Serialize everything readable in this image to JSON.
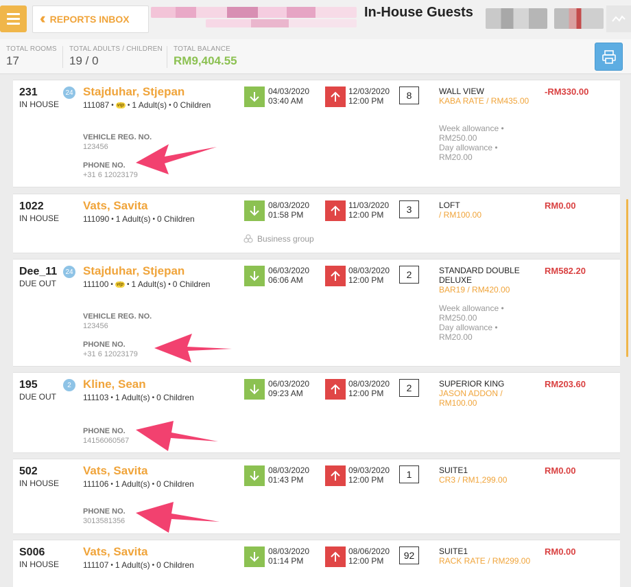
{
  "header": {
    "reports_label": "REPORTS INBOX",
    "title": "In-House Guests"
  },
  "stats": {
    "total_rooms_label": "TOTAL ROOMS",
    "total_rooms": "17",
    "adults_children_label": "TOTAL ADULTS / CHILDREN",
    "adults_children": "19 / 0",
    "balance_label": "TOTAL BALANCE",
    "balance": "RM9,404.55"
  },
  "colors": {
    "accent": "#f0a43a",
    "arrive_green": "#8cc152",
    "depart_red": "#e04646",
    "balance_red": "#d94141",
    "annotation_pink": "#f2416f"
  },
  "reservations": [
    {
      "room": "231",
      "status": "IN HOUSE",
      "badge": "24",
      "guest": "Stajduhar, Stjepan",
      "res_no": "111087",
      "vip": "vip",
      "adults": "1 Adult(s)",
      "children": "0 Children",
      "arrival_date": "04/03/2020",
      "arrival_time": "03:40 AM",
      "departure_date": "12/03/2020",
      "departure_time": "12:00 PM",
      "nights": "8",
      "room_type": "WALL VIEW",
      "rate": "KABA RATE / RM435.00",
      "allowance_week": "Week allowance •",
      "allowance_week_amt": "RM250.00",
      "allowance_day": "Day allowance •",
      "allowance_day_amt": "RM20.00",
      "vehicle_label": "VEHICLE REG. NO.",
      "vehicle": "123456",
      "phone_label": "PHONE NO.",
      "phone": "+31 6 12023179",
      "balance": "-RM330.00"
    },
    {
      "room": "1022",
      "status": "IN HOUSE",
      "guest": "Vats, Savita",
      "res_no": "111090",
      "adults": "1 Adult(s)",
      "children": "0 Children",
      "arrival_date": "08/03/2020",
      "arrival_time": "01:58 PM",
      "departure_date": "11/03/2020",
      "departure_time": "12:00 PM",
      "nights": "3",
      "room_type": "LOFT",
      "rate": "/ RM100.00",
      "group": "Business group",
      "balance": "RM0.00"
    },
    {
      "room": "Dee_11",
      "status": "DUE OUT",
      "badge": "24",
      "guest": "Stajduhar, Stjepan",
      "res_no": "111100",
      "vip": "vip",
      "adults": "1 Adult(s)",
      "children": "0 Children",
      "arrival_date": "06/03/2020",
      "arrival_time": "06:06 AM",
      "departure_date": "08/03/2020",
      "departure_time": "12:00 PM",
      "nights": "2",
      "room_type": "STANDARD DOUBLE DELUXE",
      "rate": "BAR19 / RM420.00",
      "allowance_week": "Week allowance •",
      "allowance_week_amt": "RM250.00",
      "allowance_day": "Day allowance •",
      "allowance_day_amt": "RM20.00",
      "vehicle_label": "VEHICLE REG. NO.",
      "vehicle": "123456",
      "phone_label": "PHONE NO.",
      "phone": "+31 6 12023179",
      "balance": "RM582.20"
    },
    {
      "room": "195",
      "status": "DUE OUT",
      "badge": "2",
      "guest": "Kline, Sean",
      "res_no": "111103",
      "adults": "1 Adult(s)",
      "children": "0 Children",
      "arrival_date": "06/03/2020",
      "arrival_time": "09:23 AM",
      "departure_date": "08/03/2020",
      "departure_time": "12:00 PM",
      "nights": "2",
      "room_type": "SUPERIOR KING",
      "rate": "JASON ADDON / RM100.00",
      "phone_label": "PHONE NO.",
      "phone": "14156060567",
      "balance": "RM203.60"
    },
    {
      "room": "502",
      "status": "IN HOUSE",
      "guest": "Vats, Savita",
      "res_no": "111106",
      "adults": "1 Adult(s)",
      "children": "0 Children",
      "arrival_date": "08/03/2020",
      "arrival_time": "01:43 PM",
      "departure_date": "09/03/2020",
      "departure_time": "12:00 PM",
      "nights": "1",
      "room_type": "SUITE1",
      "rate": "CR3 / RM1,299.00",
      "phone_label": "PHONE NO.",
      "phone": "3013581356",
      "balance": "RM0.00"
    },
    {
      "room": "S006",
      "status": "IN HOUSE",
      "guest": "Vats, Savita",
      "res_no": "111107",
      "adults": "1 Adult(s)",
      "children": "0 Children",
      "arrival_date": "08/03/2020",
      "arrival_time": "01:14 PM",
      "departure_date": "08/06/2020",
      "departure_time": "12:00 PM",
      "nights": "92",
      "room_type": "SUITE1",
      "rate": "RACK RATE / RM299.00",
      "balance": "RM0.00"
    }
  ]
}
